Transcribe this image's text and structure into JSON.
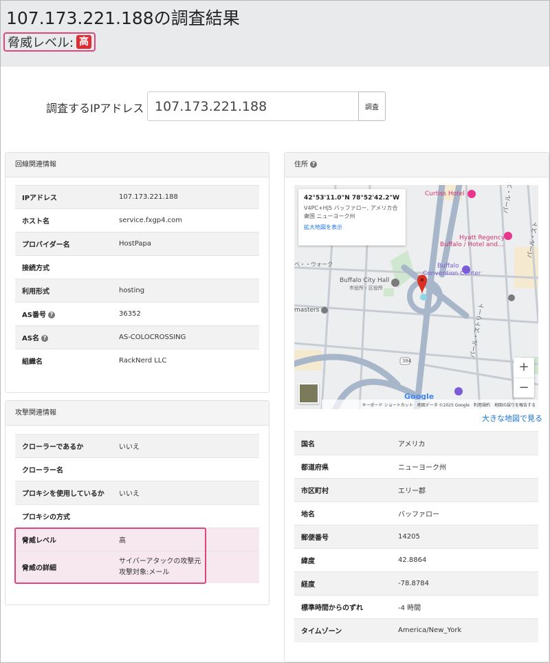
{
  "page": {
    "title": "107.173.221.188の調査結果",
    "threat_label": "脅威レベル:",
    "threat_value": "高"
  },
  "search": {
    "label": "調査するIPアドレス",
    "value": "107.173.221.188",
    "button_label": "調査"
  },
  "line_info": {
    "heading": "回線関連情報",
    "rows": [
      {
        "key": "IPアドレス",
        "value": "107.173.221.188"
      },
      {
        "key": "ホスト名",
        "value": "service.fxgp4.com"
      },
      {
        "key": "プロバイダー名",
        "value": "HostPapa"
      },
      {
        "key": "接続方式",
        "value": ""
      },
      {
        "key": "利用形式",
        "value": "hosting"
      },
      {
        "key": "AS番号",
        "value": "36352"
      },
      {
        "key": "AS名",
        "value": "AS-COLOCROSSING"
      },
      {
        "key": "組織名",
        "value": "RackNerd LLC"
      }
    ]
  },
  "attack_info": {
    "heading": "攻撃関連情報",
    "rows": [
      {
        "key": "クローラーであるか",
        "value": "いいえ"
      },
      {
        "key": "クローラー名",
        "value": ""
      },
      {
        "key": "プロキシを使用しているか",
        "value": "いいえ"
      },
      {
        "key": "プロキシの方式",
        "value": ""
      },
      {
        "key": "脅威レベル",
        "value": "高"
      },
      {
        "key": "脅威の詳細",
        "value": "サイバーアタックの攻撃元",
        "value2": "攻撃対象:メール"
      }
    ]
  },
  "address": {
    "heading": "住所",
    "map": {
      "coords": "42°53'11.0\"N 78°52'42.2\"W",
      "plus_code": "V4PC+HJ5 バッファロー, アメリカ合衆国 ニューヨーク州",
      "expand_link": "拡大地図を表示",
      "labels": {
        "curtiss": "Curtiss Hotel",
        "hyatt": "Hyatt Regency",
        "hyatt2": "Buffalo / Hotel and...",
        "convention": "Buffalo",
        "convention2": "Convention Center",
        "cityhall": "Buffalo City Hall",
        "cityhall2": "市役所・区役所",
        "masters": "masters",
        "street1": "パール・ストリート",
        "street2": "パール・スト",
        "street3": "パール・ストリート",
        "west": "ベ・・ウォーク",
        "route": "384",
        "google": "Google"
      },
      "footer": [
        "キーボード ショートカット",
        "地図データ ©2025 Google",
        "利用規約",
        "地図の誤りを報告する"
      ],
      "zoom_in": "+",
      "zoom_out": "−"
    },
    "big_map_link": "大きな地図で見る",
    "rows": [
      {
        "key": "国名",
        "value": "アメリカ"
      },
      {
        "key": "都道府県",
        "value": "ニューヨーク州"
      },
      {
        "key": "市区町村",
        "value": "エリー郡"
      },
      {
        "key": "地名",
        "value": "バッファロー"
      },
      {
        "key": "郵便番号",
        "value": "14205"
      },
      {
        "key": "緯度",
        "value": "42.8864"
      },
      {
        "key": "経度",
        "value": "-78.8784"
      },
      {
        "key": "標準時間からのずれ",
        "value": "-4 時間"
      },
      {
        "key": "タイムゾーン",
        "value": "America/New_York"
      }
    ]
  },
  "colors": {
    "threat_badge": "#dc2e35",
    "highlight_border": "#e0447a",
    "link": "#1a73e8"
  }
}
